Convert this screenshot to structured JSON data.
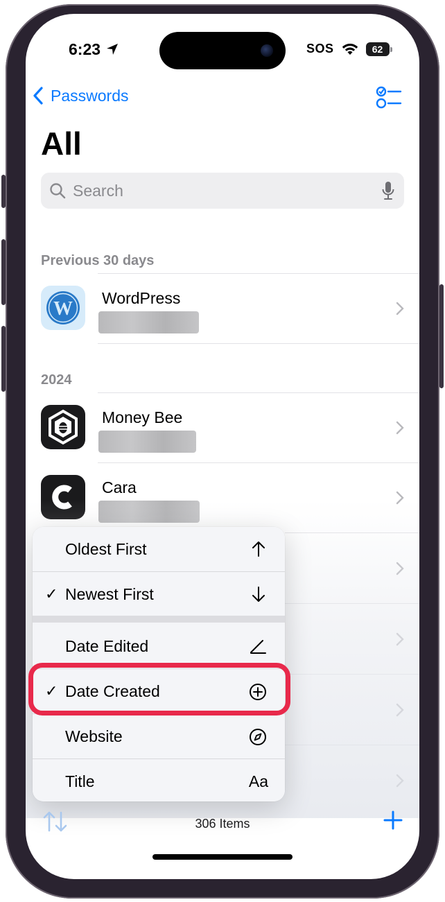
{
  "status": {
    "time": "6:23",
    "sos": "SOS",
    "battery": "62"
  },
  "nav": {
    "back_label": "Passwords",
    "title": "All"
  },
  "search": {
    "placeholder": "Search"
  },
  "sections": [
    {
      "header": "Previous 30 days"
    },
    {
      "header": "2024"
    }
  ],
  "rows": [
    {
      "name": "WordPress",
      "icon": "wordpress-logo"
    },
    {
      "name": "Money Bee",
      "icon": "money-bee-logo"
    },
    {
      "name": "Cara",
      "icon": "cara-logo"
    }
  ],
  "sort_menu": {
    "items": [
      {
        "label": "Oldest First",
        "icon": "arrow-up-icon",
        "checked": false
      },
      {
        "label": "Newest First",
        "icon": "arrow-down-icon",
        "checked": true
      },
      {
        "label": "Date Edited",
        "icon": "pencil-icon",
        "checked": false
      },
      {
        "label": "Date Created",
        "icon": "plus-circle-icon",
        "checked": true
      },
      {
        "label": "Website",
        "icon": "compass-icon",
        "checked": false
      },
      {
        "label": "Title",
        "icon": "Aa",
        "checked": false
      }
    ],
    "check_mark": "✓",
    "highlight_color": "#e8294b"
  },
  "toolbar": {
    "count_label": "306 Items"
  },
  "colors": {
    "accent": "#0a7aff"
  }
}
